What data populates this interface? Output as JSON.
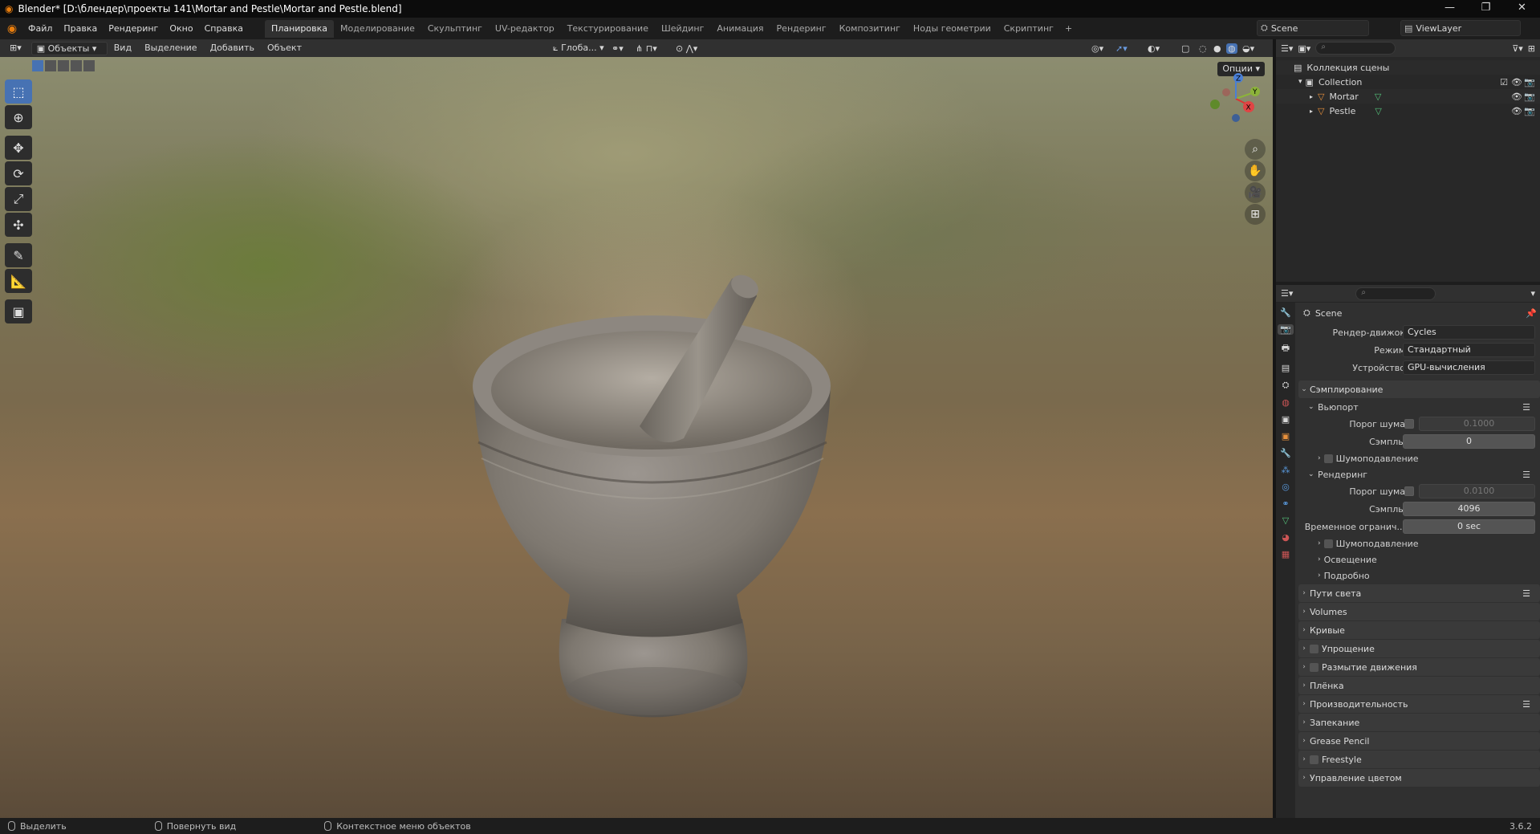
{
  "window": {
    "title": "Blender* [D:\\блендер\\проекты 141\\Mortar and Pestle\\Mortar and Pestle.blend]",
    "min": "—",
    "max": "❐",
    "close": "✕"
  },
  "menu": [
    "Файл",
    "Правка",
    "Рендеринг",
    "Окно",
    "Справка"
  ],
  "workspaces": [
    "Планировка",
    "Моделирование",
    "Скульптинг",
    "UV-редактор",
    "Текстурирование",
    "Шейдинг",
    "Анимация",
    "Рендеринг",
    "Композитинг",
    "Ноды геометрии",
    "Скриптинг"
  ],
  "active_workspace": "Планировка",
  "scene_name": "Scene",
  "view_layer": "ViewLayer",
  "viewport_header": {
    "mode": "Объекты",
    "menus": [
      "Вид",
      "Выделение",
      "Добавить",
      "Объект"
    ],
    "orientation": "Глоба..."
  },
  "viewport": {
    "options_label": "Опции",
    "gizmo": {
      "x": "X",
      "y": "Y",
      "z": "Z"
    }
  },
  "toolbar": [
    "select-box",
    "cursor",
    "move",
    "rotate",
    "scale",
    "transform",
    "annotate",
    "measure",
    "add-cube"
  ],
  "outliner": {
    "root": "Коллекция сцены",
    "collection": "Collection",
    "objects": [
      "Mortar",
      "Pestle"
    ]
  },
  "properties": {
    "scene": "Scene",
    "render_engine_label": "Рендер-движок",
    "render_engine": "Cycles",
    "mode_label": "Режим",
    "mode": "Стандартный",
    "device_label": "Устройство",
    "device": "GPU-вычисления",
    "sampling": "Сэмплирование",
    "viewport": "Вьюпорт",
    "noise_threshold_label": "Порог шума",
    "viewport_noise": "0.1000",
    "samples_label": "Сэмплы",
    "viewport_samples": "0",
    "denoise": "Шумоподавление",
    "render": "Рендеринг",
    "render_noise": "0.0100",
    "render_samples": "4096",
    "time_limit_label": "Временное огранич...",
    "time_limit": "0 sec",
    "lights": "Освещение",
    "advanced": "Подробно",
    "panels": [
      "Пути света",
      "Volumes",
      "Кривые",
      "Упрощение",
      "Размытие движения",
      "Плёнка",
      "Производительность",
      "Запекание",
      "Grease Pencil",
      "Freestyle",
      "Управление цветом"
    ]
  },
  "status": {
    "select": "Выделить",
    "rotate": "Повернуть вид",
    "context": "Контекстное меню объектов",
    "version": "3.6.2"
  }
}
